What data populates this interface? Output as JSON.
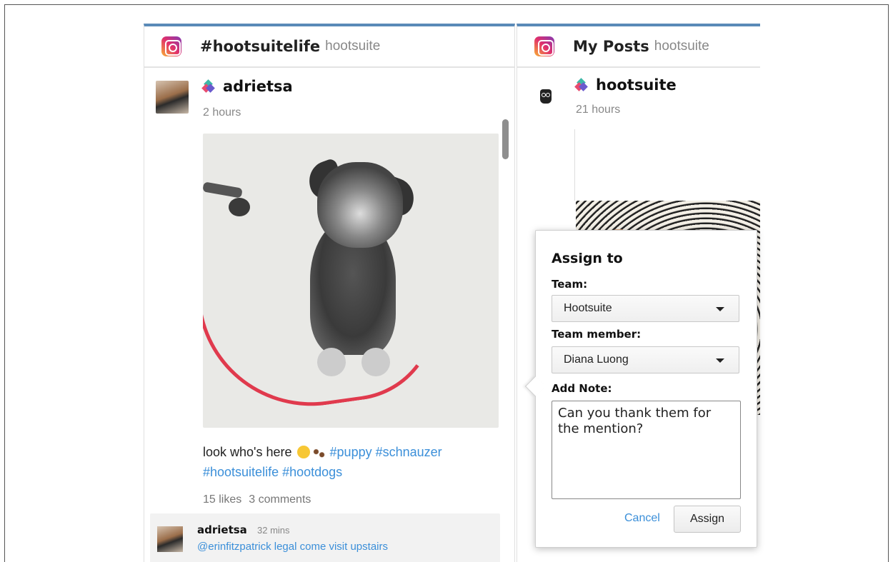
{
  "left_stream": {
    "title": "#hootsuitelife",
    "subtitle": "hootsuite",
    "icon": "instagram-icon",
    "post": {
      "author": "adrietsa",
      "time": "2 hours",
      "caption_text": "look who's here",
      "hashtags_line1": "#puppy #schnauzer",
      "hashtags_line2": "#hootsuitelife #hootdogs",
      "likes": "15 likes",
      "comments": "3 comments"
    },
    "comment": {
      "author": "adrietsa",
      "time": "32 mins",
      "text": "@erinfitzpatrick legal come visit upstairs"
    }
  },
  "right_stream": {
    "title": "My Posts",
    "subtitle": "hootsuite",
    "icon": "instagram-icon",
    "post": {
      "author": "hootsuite",
      "time": "21 hours"
    }
  },
  "assign_popover": {
    "title": "Assign to",
    "team_label": "Team:",
    "team_value": "Hootsuite",
    "member_label": "Team member:",
    "member_value": "Diana Luong",
    "note_label": "Add Note:",
    "note_value": "Can you thank them for the mention?",
    "cancel_label": "Cancel",
    "assign_label": "Assign"
  },
  "colors": {
    "link": "#3b8fd9",
    "stream_accent": "#5a8ab8"
  }
}
